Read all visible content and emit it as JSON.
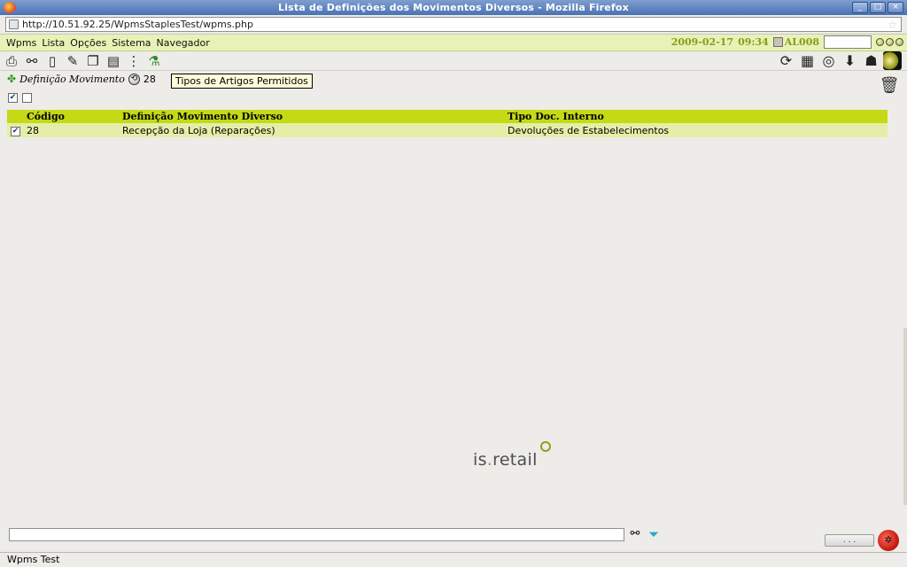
{
  "window": {
    "title": "Lista de Definições dos Movimentos Diversos - Mozilla Firefox",
    "controls": [
      "_",
      "□",
      "×"
    ]
  },
  "browser": {
    "url": "http://10.51.92.25/WpmsStaplesTest/wpms.php",
    "bookmark_glyph": "☆"
  },
  "menubar": {
    "items": [
      "Wpms",
      "Lista",
      "Opções",
      "Sistema",
      "Navegador"
    ],
    "date": "2009-02-17",
    "time": "09:34",
    "user": "AL008",
    "command_value": ""
  },
  "toolbar": {
    "left_icons": [
      {
        "name": "printer-icon",
        "glyph": "⎙"
      },
      {
        "name": "binoculars-icon",
        "glyph": "⚯"
      },
      {
        "name": "new-document-icon",
        "glyph": "▯"
      },
      {
        "name": "edit-icon",
        "glyph": "✎"
      },
      {
        "name": "copy-document-icon",
        "glyph": "❐"
      },
      {
        "name": "batch-icon",
        "glyph": "▤"
      },
      {
        "name": "more-icon",
        "glyph": "⋮"
      },
      {
        "name": "flask-icon",
        "glyph": "⚗"
      }
    ],
    "right_icons": [
      {
        "name": "refresh-icon",
        "glyph": "⟳"
      },
      {
        "name": "save-icon",
        "glyph": "▦"
      },
      {
        "name": "lifebuoy-icon",
        "glyph": "◎"
      },
      {
        "name": "download-icon",
        "glyph": "⬇"
      },
      {
        "name": "user-icon",
        "glyph": "☗"
      },
      {
        "name": "moon-icon",
        "glyph": ""
      }
    ]
  },
  "tooltip": {
    "text": "Tipos de Artigos Permitidos"
  },
  "section": {
    "label": "Definição Movimento",
    "count": "28"
  },
  "table": {
    "columns": [
      "Código",
      "Definição Movimento Diverso",
      "Tipo Doc. Interno"
    ],
    "rows": [
      {
        "checked": "✔",
        "codigo": "28",
        "definicao": "Recepção da Loja (Reparações)",
        "tipo": "Devoluções de Estabelecimentos"
      }
    ]
  },
  "select_controls": {
    "checked": "✔",
    "unchecked": ""
  },
  "logo": {
    "prefix": "is",
    "dot": ".",
    "suffix": "retail"
  },
  "footer": {
    "filter_value": "",
    "more_button": ". . .",
    "status_text": "Wpms Test"
  },
  "colors": {
    "menubar_bg": "#e7f3b6",
    "table_header_bg": "#c5da14",
    "table_row_bg": "#e5eea8",
    "accent_text": "#8a9a1e"
  }
}
